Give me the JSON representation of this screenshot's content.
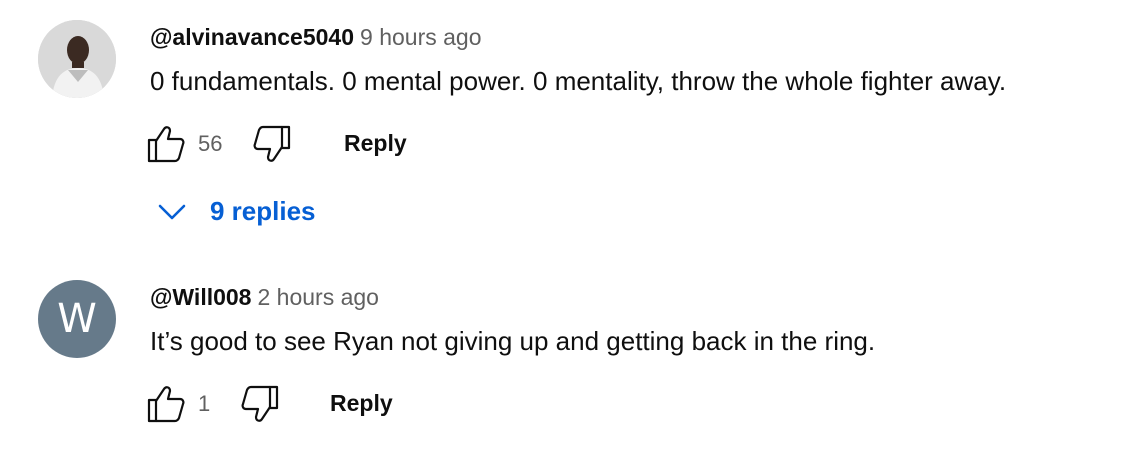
{
  "comments": [
    {
      "handle": "@alvinavance5040",
      "time": "9 hours ago",
      "text": "0 fundamentals. 0 mental power. 0 mentality, throw the whole fighter away.",
      "likes": "56",
      "reply_label": "Reply",
      "replies_label": "9 replies",
      "avatar": "photo"
    },
    {
      "handle": "@Will008",
      "time": "2 hours ago",
      "text": "It’s good to see Ryan not giving up and getting back in the ring.",
      "likes": "1",
      "reply_label": "Reply",
      "avatar_letter": "W",
      "avatar_color": "#667a8a"
    }
  ],
  "colors": {
    "link": "#065fd4",
    "secondary_text": "#606060"
  },
  "icons": [
    "thumb-up-icon",
    "thumb-down-icon",
    "chevron-down-icon"
  ]
}
